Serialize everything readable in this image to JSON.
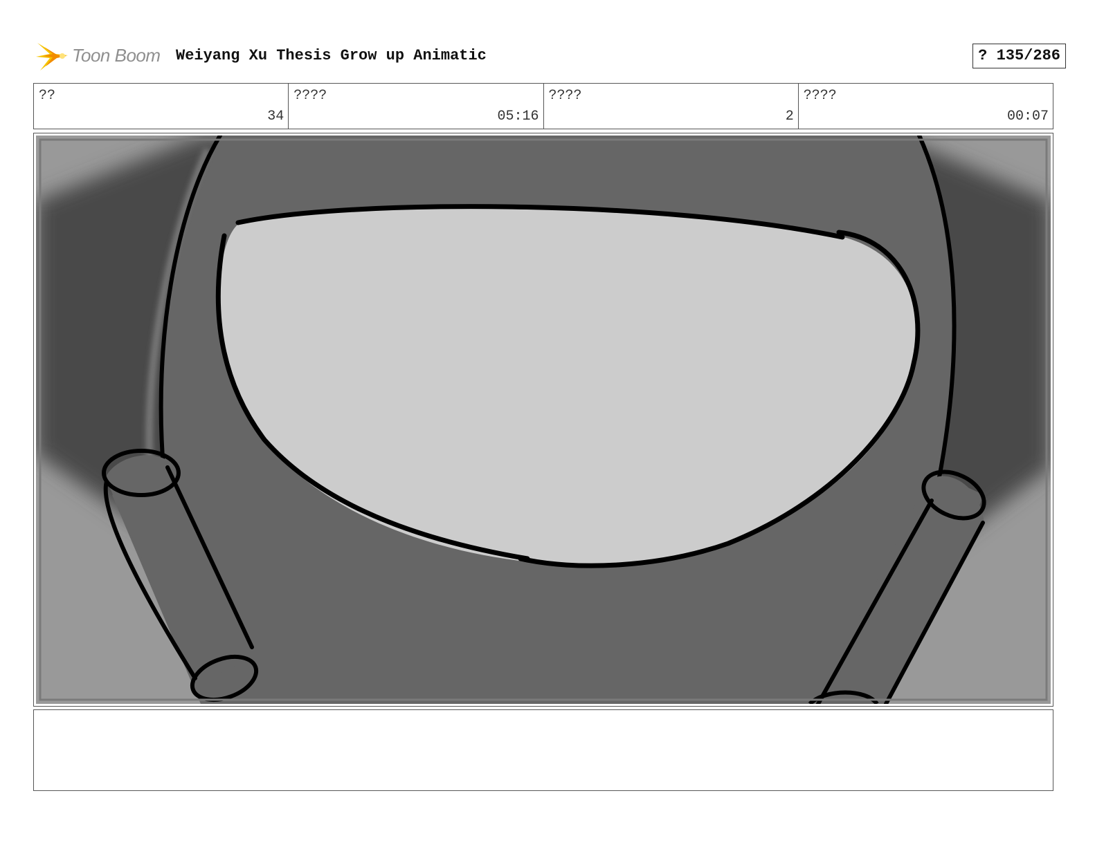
{
  "header": {
    "logo_text": "Toon Boom",
    "logo_icon": "starburst-logo-icon",
    "title": "Weiyang Xu Thesis Grow up Animatic",
    "page_counter": "? 135/286"
  },
  "info": [
    {
      "label": "??",
      "value": "34"
    },
    {
      "label": "????",
      "value": "05:16"
    },
    {
      "label": "????",
      "value": "2"
    },
    {
      "label": "????",
      "value": "00:07"
    }
  ],
  "panel": {
    "subject": "character-visor-sketch"
  },
  "notes": {
    "text": ""
  },
  "colors": {
    "logo_yellow": "#f5c400",
    "logo_orange": "#f28c00",
    "background_light": "#999999",
    "background_dark": "#4a4a4a",
    "body": "#666666",
    "visor": "#cccccc",
    "ink": "#000000"
  }
}
